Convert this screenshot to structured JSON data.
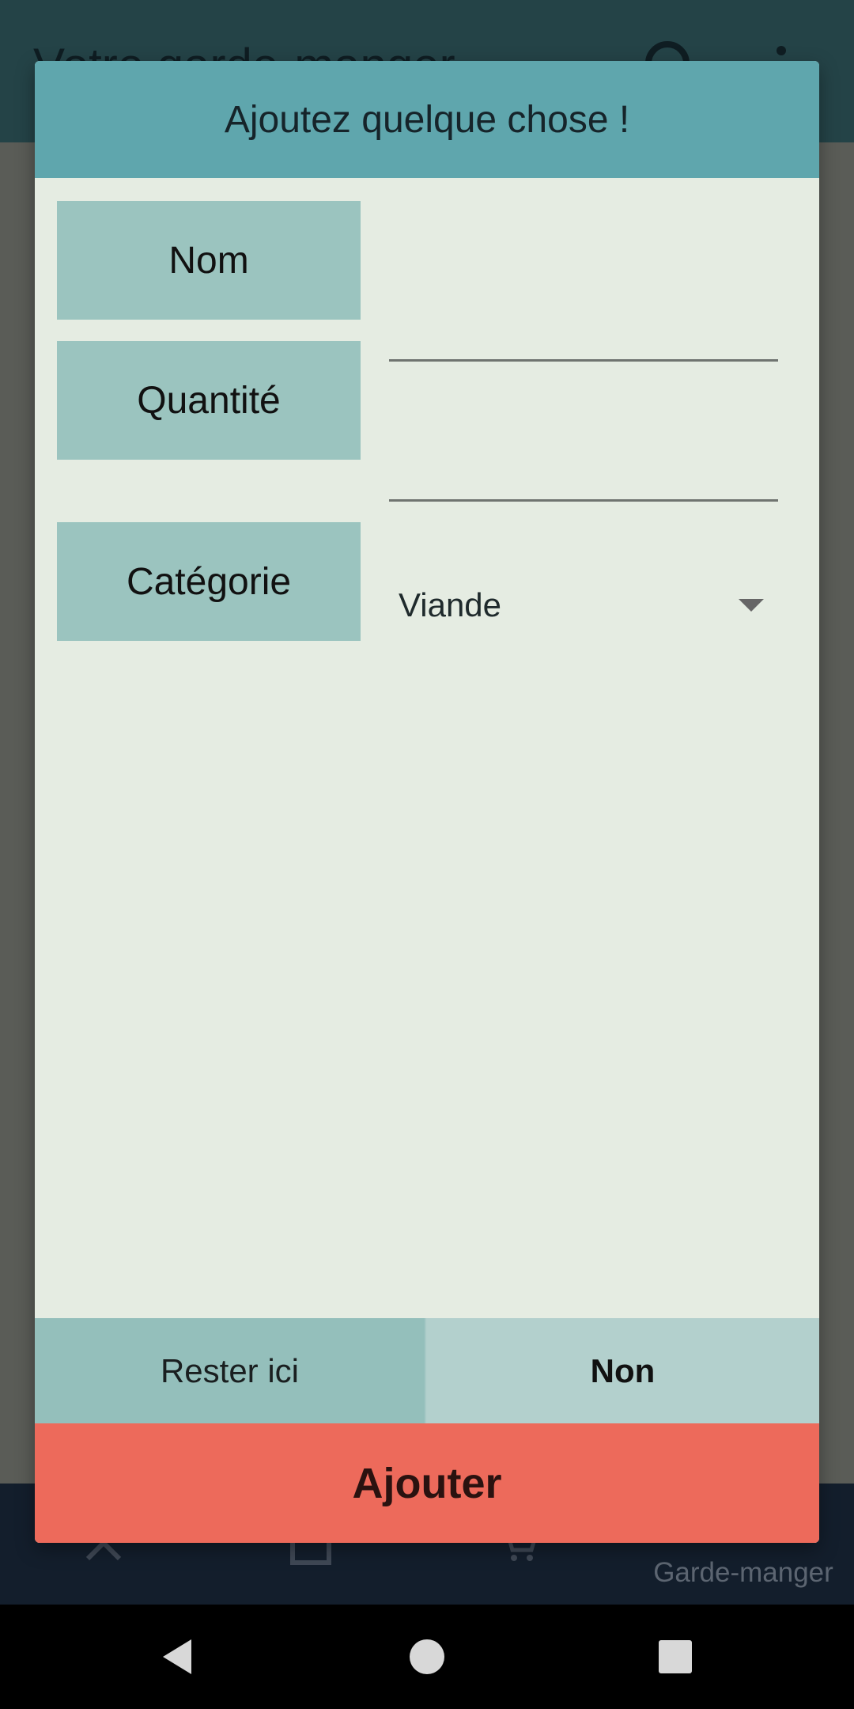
{
  "app": {
    "title": "Votre garde-manger",
    "bottom_nav": {
      "items": [
        {
          "icon": "close-icon",
          "label": ""
        },
        {
          "icon": "list-icon",
          "label": ""
        },
        {
          "icon": "cart-icon",
          "label": ""
        },
        {
          "icon": "pantry-icon",
          "label": "Garde-manger"
        }
      ]
    }
  },
  "dialog": {
    "title": "Ajoutez quelque chose !",
    "name_label": "Nom",
    "name_value": "",
    "quantity_label": "Quantité",
    "quantity_value": "",
    "category_label": "Catégorie",
    "category_value": "Viande",
    "stay_button": "Rester ici",
    "no_button": "Non",
    "add_button": "Ajouter"
  },
  "colors": {
    "header": "#5fa6ad",
    "label_bg": "#9bc4bf",
    "add_button": "#ed6a5b",
    "dialog_bg": "#e5ece2"
  }
}
